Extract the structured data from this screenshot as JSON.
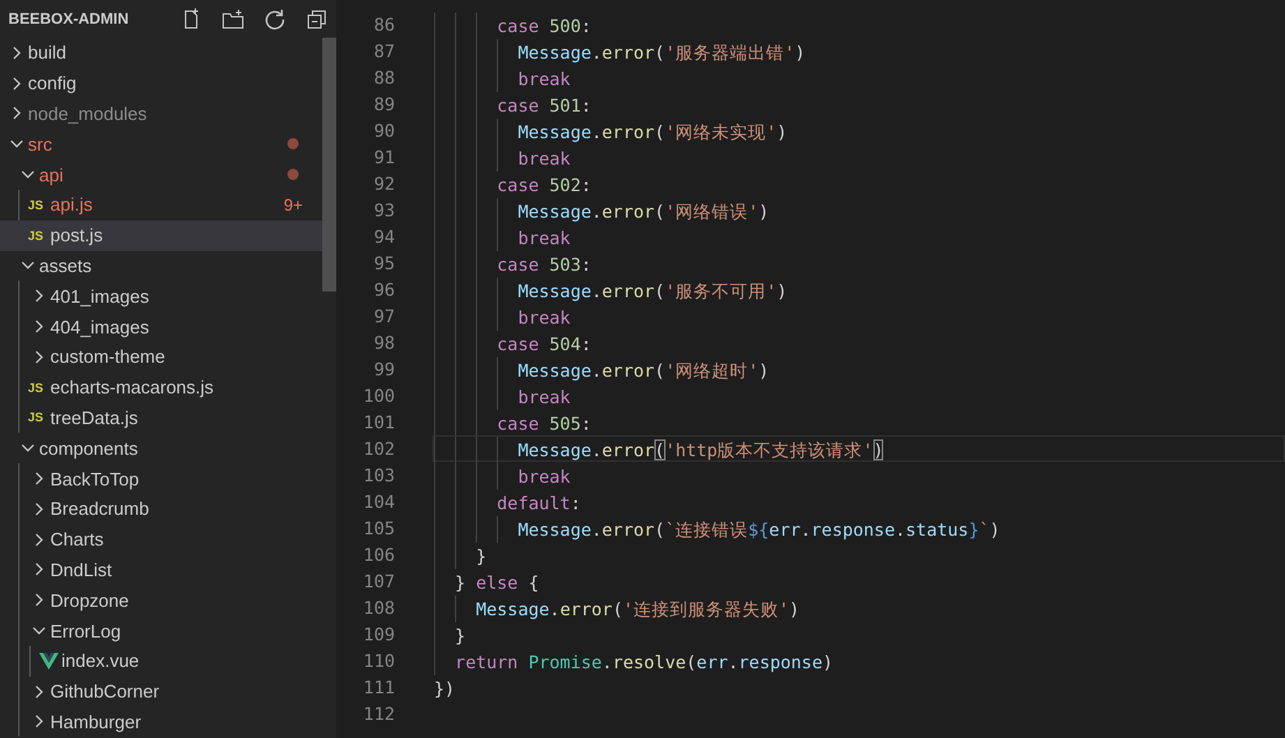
{
  "explorer": {
    "title": "BEEBOX-ADMIN",
    "tree": [
      {
        "name": "build",
        "kind": "folder",
        "expanded": false,
        "selected": false
      },
      {
        "name": "config",
        "kind": "folder",
        "expanded": false,
        "selected": false
      },
      {
        "name": "node_modules",
        "kind": "folder",
        "expanded": false,
        "selected": false,
        "color": "#8c8c8c"
      },
      {
        "name": "src",
        "kind": "folder",
        "expanded": true,
        "selected": false,
        "color": "#e8735f",
        "dot": true,
        "children": [
          {
            "name": "api",
            "kind": "folder",
            "expanded": true,
            "selected": false,
            "color": "#e8735f",
            "dot": true,
            "children": [
              {
                "name": "api.js",
                "kind": "js",
                "icon_text": "JS",
                "selected": false,
                "color": "#e8735f",
                "badge": "9+"
              },
              {
                "name": "post.js",
                "kind": "js",
                "icon_text": "JS",
                "selected": true
              }
            ]
          },
          {
            "name": "assets",
            "kind": "folder",
            "expanded": true,
            "selected": false,
            "children": [
              {
                "name": "401_images",
                "kind": "folder",
                "expanded": false,
                "selected": false
              },
              {
                "name": "404_images",
                "kind": "folder",
                "expanded": false,
                "selected": false
              },
              {
                "name": "custom-theme",
                "kind": "folder",
                "expanded": false,
                "selected": false
              },
              {
                "name": "echarts-macarons.js",
                "kind": "js",
                "icon_text": "JS",
                "selected": false
              },
              {
                "name": "treeData.js",
                "kind": "js",
                "icon_text": "JS",
                "selected": false
              }
            ]
          },
          {
            "name": "components",
            "kind": "folder",
            "expanded": true,
            "selected": false,
            "children": [
              {
                "name": "BackToTop",
                "kind": "folder",
                "expanded": false,
                "selected": false
              },
              {
                "name": "Breadcrumb",
                "kind": "folder",
                "expanded": false,
                "selected": false
              },
              {
                "name": "Charts",
                "kind": "folder",
                "expanded": false,
                "selected": false
              },
              {
                "name": "DndList",
                "kind": "folder",
                "expanded": false,
                "selected": false
              },
              {
                "name": "Dropzone",
                "kind": "folder",
                "expanded": false,
                "selected": false
              },
              {
                "name": "ErrorLog",
                "kind": "folder",
                "expanded": true,
                "selected": false,
                "children": [
                  {
                    "name": "index.vue",
                    "kind": "vue",
                    "selected": false
                  }
                ]
              },
              {
                "name": "GithubCorner",
                "kind": "folder",
                "expanded": false,
                "selected": false
              },
              {
                "name": "Hamburger",
                "kind": "folder",
                "expanded": false,
                "selected": false
              }
            ]
          }
        ]
      }
    ]
  },
  "editor": {
    "lines": [
      {
        "number": "86",
        "tokens": [
          {
            "text": "      case ",
            "kind": "keyword"
          },
          {
            "text": "500",
            "kind": "number"
          },
          {
            "text": ":",
            "kind": "plain"
          }
        ]
      },
      {
        "number": "87",
        "tokens": [
          {
            "text": "        Message",
            "kind": "variable"
          },
          {
            "text": ".",
            "kind": "plain"
          },
          {
            "text": "error",
            "kind": "function"
          },
          {
            "text": "(",
            "kind": "plain"
          },
          {
            "text": "'服务器端出错'",
            "kind": "string"
          },
          {
            "text": ")",
            "kind": "plain"
          }
        ]
      },
      {
        "number": "88",
        "tokens": [
          {
            "text": "        break",
            "kind": "keyword"
          }
        ]
      },
      {
        "number": "89",
        "tokens": [
          {
            "text": "      case ",
            "kind": "keyword"
          },
          {
            "text": "501",
            "kind": "number"
          },
          {
            "text": ":",
            "kind": "plain"
          }
        ]
      },
      {
        "number": "90",
        "tokens": [
          {
            "text": "        Message",
            "kind": "variable"
          },
          {
            "text": ".",
            "kind": "plain"
          },
          {
            "text": "error",
            "kind": "function"
          },
          {
            "text": "(",
            "kind": "plain"
          },
          {
            "text": "'网络未实现'",
            "kind": "string"
          },
          {
            "text": ")",
            "kind": "plain"
          }
        ]
      },
      {
        "number": "91",
        "tokens": [
          {
            "text": "        break",
            "kind": "keyword"
          }
        ]
      },
      {
        "number": "92",
        "tokens": [
          {
            "text": "      case ",
            "kind": "keyword"
          },
          {
            "text": "502",
            "kind": "number"
          },
          {
            "text": ":",
            "kind": "plain"
          }
        ]
      },
      {
        "number": "93",
        "tokens": [
          {
            "text": "        Message",
            "kind": "variable"
          },
          {
            "text": ".",
            "kind": "plain"
          },
          {
            "text": "error",
            "kind": "function"
          },
          {
            "text": "(",
            "kind": "plain"
          },
          {
            "text": "'网络错误'",
            "kind": "string"
          },
          {
            "text": ")",
            "kind": "plain"
          }
        ]
      },
      {
        "number": "94",
        "tokens": [
          {
            "text": "        break",
            "kind": "keyword"
          }
        ]
      },
      {
        "number": "95",
        "tokens": [
          {
            "text": "      case ",
            "kind": "keyword"
          },
          {
            "text": "503",
            "kind": "number"
          },
          {
            "text": ":",
            "kind": "plain"
          }
        ]
      },
      {
        "number": "96",
        "tokens": [
          {
            "text": "        Message",
            "kind": "variable"
          },
          {
            "text": ".",
            "kind": "plain"
          },
          {
            "text": "error",
            "kind": "function"
          },
          {
            "text": "(",
            "kind": "plain"
          },
          {
            "text": "'服务不可用'",
            "kind": "string"
          },
          {
            "text": ")",
            "kind": "plain"
          }
        ]
      },
      {
        "number": "97",
        "tokens": [
          {
            "text": "        break",
            "kind": "keyword"
          }
        ]
      },
      {
        "number": "98",
        "tokens": [
          {
            "text": "      case ",
            "kind": "keyword"
          },
          {
            "text": "504",
            "kind": "number"
          },
          {
            "text": ":",
            "kind": "plain"
          }
        ]
      },
      {
        "number": "99",
        "tokens": [
          {
            "text": "        Message",
            "kind": "variable"
          },
          {
            "text": ".",
            "kind": "plain"
          },
          {
            "text": "error",
            "kind": "function"
          },
          {
            "text": "(",
            "kind": "plain"
          },
          {
            "text": "'网络超时'",
            "kind": "string"
          },
          {
            "text": ")",
            "kind": "plain"
          }
        ]
      },
      {
        "number": "100",
        "tokens": [
          {
            "text": "        break",
            "kind": "keyword"
          }
        ]
      },
      {
        "number": "101",
        "tokens": [
          {
            "text": "      case ",
            "kind": "keyword"
          },
          {
            "text": "505",
            "kind": "number"
          },
          {
            "text": ":",
            "kind": "plain"
          }
        ]
      },
      {
        "number": "102",
        "current": true,
        "tokens": [
          {
            "text": "        Message",
            "kind": "variable"
          },
          {
            "text": ".",
            "kind": "plain"
          },
          {
            "text": "error",
            "kind": "function"
          },
          {
            "text": "(",
            "kind": "bracket-match"
          },
          {
            "text": "'http版本不支持该请求'",
            "kind": "string"
          },
          {
            "text": ")",
            "kind": "bracket-match"
          }
        ]
      },
      {
        "number": "103",
        "tokens": [
          {
            "text": "        break",
            "kind": "keyword"
          }
        ]
      },
      {
        "number": "104",
        "tokens": [
          {
            "text": "      default",
            "kind": "keyword"
          },
          {
            "text": ":",
            "kind": "plain"
          }
        ]
      },
      {
        "number": "105",
        "tokens": [
          {
            "text": "        Message",
            "kind": "variable"
          },
          {
            "text": ".",
            "kind": "plain"
          },
          {
            "text": "error",
            "kind": "function"
          },
          {
            "text": "(",
            "kind": "plain"
          },
          {
            "text": "`连接错误",
            "kind": "string"
          },
          {
            "text": "${",
            "kind": "template"
          },
          {
            "text": "err",
            "kind": "variable"
          },
          {
            "text": ".",
            "kind": "plain"
          },
          {
            "text": "response",
            "kind": "variable"
          },
          {
            "text": ".",
            "kind": "plain"
          },
          {
            "text": "status",
            "kind": "variable"
          },
          {
            "text": "}",
            "kind": "template"
          },
          {
            "text": "`",
            "kind": "string"
          },
          {
            "text": ")",
            "kind": "plain"
          }
        ]
      },
      {
        "number": "106",
        "tokens": [
          {
            "text": "    }",
            "kind": "plain"
          }
        ]
      },
      {
        "number": "107",
        "tokens": [
          {
            "text": "  } ",
            "kind": "plain"
          },
          {
            "text": "else",
            "kind": "keyword"
          },
          {
            "text": " {",
            "kind": "plain"
          }
        ]
      },
      {
        "number": "108",
        "tokens": [
          {
            "text": "    Message",
            "kind": "variable"
          },
          {
            "text": ".",
            "kind": "plain"
          },
          {
            "text": "error",
            "kind": "function"
          },
          {
            "text": "(",
            "kind": "plain"
          },
          {
            "text": "'连接到服务器失败'",
            "kind": "string"
          },
          {
            "text": ")",
            "kind": "plain"
          }
        ]
      },
      {
        "number": "109",
        "tokens": [
          {
            "text": "  }",
            "kind": "plain"
          }
        ]
      },
      {
        "number": "110",
        "tokens": [
          {
            "text": "  return ",
            "kind": "keyword"
          },
          {
            "text": "Promise",
            "kind": "class"
          },
          {
            "text": ".",
            "kind": "plain"
          },
          {
            "text": "resolve",
            "kind": "function"
          },
          {
            "text": "(",
            "kind": "plain"
          },
          {
            "text": "err",
            "kind": "variable"
          },
          {
            "text": ".",
            "kind": "plain"
          },
          {
            "text": "response",
            "kind": "variable"
          },
          {
            "text": ")",
            "kind": "plain"
          }
        ]
      },
      {
        "number": "111",
        "tokens": [
          {
            "text": "})",
            "kind": "plain"
          }
        ]
      },
      {
        "number": "112"
      }
    ]
  }
}
